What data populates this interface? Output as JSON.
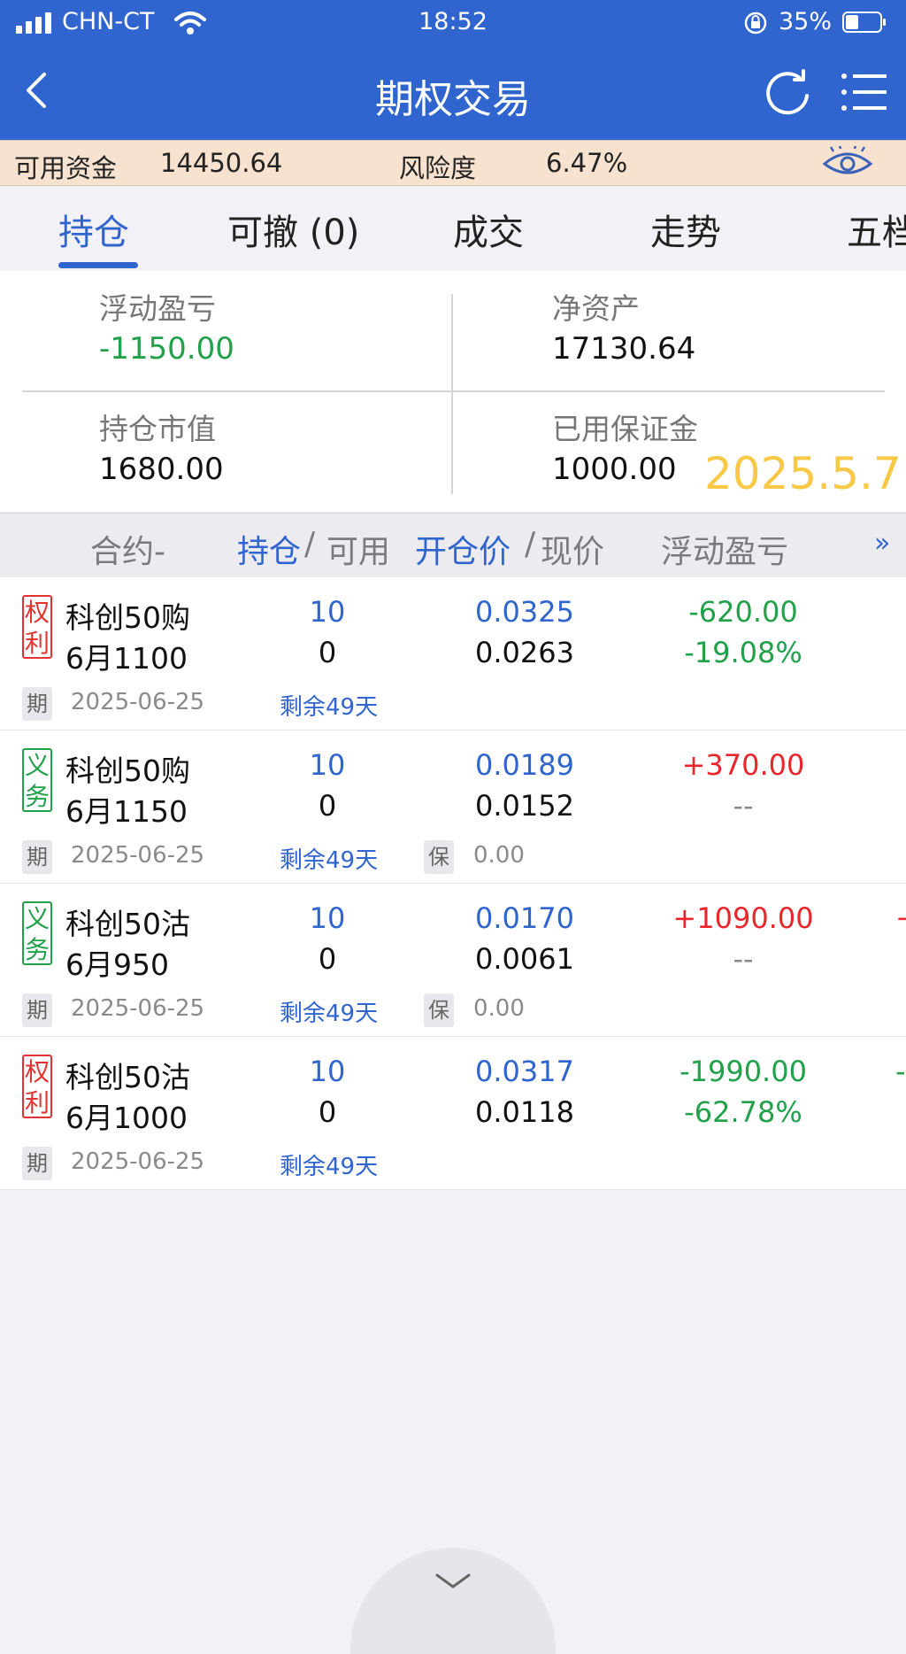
{
  "status_bar": {
    "carrier": "CHN-CT",
    "time": "18:52",
    "battery": "35%"
  },
  "nav": {
    "title": "期权交易"
  },
  "funds": {
    "available_label": "可用资金",
    "available_value": "14450.64",
    "risk_label": "风险度",
    "risk_value": "6.47%"
  },
  "tabs": [
    {
      "label": "持仓"
    },
    {
      "label": "可撤 (0)"
    },
    {
      "label": "成交"
    },
    {
      "label": "走势"
    },
    {
      "label": "五档"
    }
  ],
  "summary": {
    "floating_pl_label": "浮动盈亏",
    "floating_pl_value": "-1150.00",
    "net_assets_label": "净资产",
    "net_assets_value": "17130.64",
    "position_value_label": "持仓市值",
    "position_value_value": "1680.00",
    "margin_used_label": "已用保证金",
    "margin_used_value": "1000.00",
    "watermark_date": "2025.5.7"
  },
  "table_header": {
    "contract": "合约-",
    "position": "持仓",
    "sep1": "/",
    "available": "可用",
    "open_price": "开仓价",
    "sep2": "/",
    "current_price": "现价",
    "floating_pl": "浮动盈亏",
    "more": "»"
  },
  "rows": [
    {
      "badge_top": "权",
      "badge_bottom": "利",
      "badge_color": "red",
      "name": "科创50购",
      "month_strike": "6月1100",
      "position": "10",
      "available": "0",
      "open_price": "0.0325",
      "current_price": "0.0263",
      "pl": "-620.00",
      "pl_color": "green",
      "pl_pct": "-19.08%",
      "pl_pct_color": "green",
      "term_tag": "期",
      "expiry": "2025-06-25",
      "days_left": "剩余49天",
      "margin_tag": "",
      "margin": "",
      "edge": ""
    },
    {
      "badge_top": "义",
      "badge_bottom": "务",
      "badge_color": "green",
      "name": "科创50购",
      "month_strike": "6月1150",
      "position": "10",
      "available": "0",
      "open_price": "0.0189",
      "current_price": "0.0152",
      "pl": "+370.00",
      "pl_color": "red",
      "pl_pct": "--",
      "pl_pct_color": "grey",
      "term_tag": "期",
      "expiry": "2025-06-25",
      "days_left": "剩余49天",
      "margin_tag": "保",
      "margin": "0.00",
      "edge": ""
    },
    {
      "badge_top": "义",
      "badge_bottom": "务",
      "badge_color": "green",
      "name": "科创50沽",
      "month_strike": "6月950",
      "position": "10",
      "available": "0",
      "open_price": "0.0170",
      "current_price": "0.0061",
      "pl": "+1090.00",
      "pl_color": "red",
      "pl_pct": "--",
      "pl_pct_color": "grey",
      "term_tag": "期",
      "expiry": "2025-06-25",
      "days_left": "剩余49天",
      "margin_tag": "保",
      "margin": "0.00",
      "edge": "+",
      "edge_color": "red"
    },
    {
      "badge_top": "权",
      "badge_bottom": "利",
      "badge_color": "red",
      "name": "科创50沽",
      "month_strike": "6月1000",
      "position": "10",
      "available": "0",
      "open_price": "0.0317",
      "current_price": "0.0118",
      "pl": "-1990.00",
      "pl_color": "green",
      "pl_pct": "-62.78%",
      "pl_pct_color": "green",
      "term_tag": "期",
      "expiry": "2025-06-25",
      "days_left": "剩余49天",
      "margin_tag": "",
      "margin": "",
      "edge": "-",
      "edge_color": "green"
    }
  ],
  "colors": {
    "brand_blue": "#3064cf",
    "loss_green": "#22a04a",
    "gain_red": "#e8262b",
    "funds_bg": "#f6e2cf",
    "watermark": "#f8c947"
  }
}
